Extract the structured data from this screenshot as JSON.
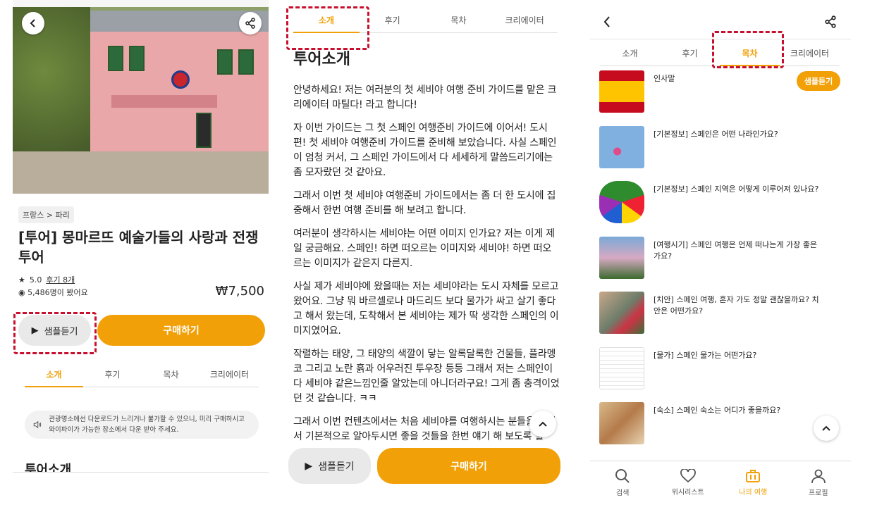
{
  "panel1": {
    "breadcrumb": "프랑스 > 파리",
    "title": "[투어] 몽마르뜨 예술가들의 사랑과 전쟁 투어",
    "rating": "5.0",
    "reviews_link": "후기 8개",
    "views": "5,486명이 봤어요",
    "price": "₩7,500",
    "sample_label": "샘플듣기",
    "buy_label": "구매하기",
    "tabs": [
      "소개",
      "후기",
      "목차",
      "크리에이터"
    ],
    "notice": "관광명소에선 다운로드가 느리거나 불가할 수 있으니, 미리 구매하시고 와이파이가 가능한 장소에서 다운 받아 주세요.",
    "section_title": "투어소개"
  },
  "panel2": {
    "tabs": [
      "소개",
      "후기",
      "목차",
      "크리에이터"
    ],
    "title": "투어소개",
    "paragraphs": [
      "안녕하세요! 저는 여러분의 첫 세비야 여행 준비 가이드를 맡은 크리에이터 마틸다! 라고 합니다!",
      "자 이번 가이드는 그 첫 스페인 여행준비 가이드에 이어서! 도시편! 첫 세비야 여행준비 가이드를 준비해 보았습니다. 사실 스페인이 엄청 커서, 그 스페인 가이드에서 다 세세하게 말씀드리기에는 좀 모자랐던 것 같아요.",
      "그래서 이번 첫 세비야 여행준비 가이드에서는 좀 더 한 도시에 집중해서 한번 여행 준비를 해 보려고 합니다.",
      "여러분이 생각하시는 세비야는 어떤 이미지 인가요? 저는 이게 제일 궁금해요. 스페인! 하면 떠오르는 이미지와 세비야! 하면 떠오르는 이미지가 같은지 다른지.",
      "사실 제가 세비야에 왔을때는 저는 세비야라는 도시 자체를 모르고 왔어요. 그냥 뭐 바르셀로나 마드리드 보다 물가가 싸고 살기 좋다고 해서 왔는데, 도착해서 본 세비야는 제가 딱 생각한 스페인의 이미지였어요.",
      "작렬하는 태양, 그 태양의 색깔이 닿는 알록달록한 건물들, 플라멩코 그리고 노란 흙과 어우러진 투우장 등등 그래서 저는 스페인이 다 세비야 같은느낌인줄 알았는데 아니더라구요! 그게 좀 충격이었던 것 같습니다. ㅋㅋ",
      "그래서 이번 컨텐츠에서는 처음 세비야를 여행하시는 분들을 위해서 기본적으로 알아두시면 좋을 것들을 한번 얘기 해 보도록 할"
    ],
    "sample_label": "샘플듣기",
    "buy_label": "구매하기"
  },
  "panel3": {
    "tabs": [
      "소개",
      "후기",
      "목차",
      "크리에이터"
    ],
    "items": [
      {
        "title": "인사말",
        "sample": "샘플듣기"
      },
      {
        "title": "[기본정보] 스페인은 어떤 나라인가요?"
      },
      {
        "title": "[기본정보] 스페인 지역은 어떻게 이루어져 있나요?"
      },
      {
        "title": "[여행시기] 스페인 여행은 언제 떠나는게 가장 좋은 가요?"
      },
      {
        "title": "[치안] 스페인 여행, 혼자 가도 정말 괜찮을까요? 치안은 어떤가요?"
      },
      {
        "title": "[물가] 스페인 물가는 어떤가요?"
      },
      {
        "title": "[숙소] 스페인 숙소는 어디가 좋을까요?"
      }
    ],
    "nav": [
      "검색",
      "위시리스트",
      "나의 여행",
      "프로필"
    ]
  },
  "colors": {
    "accent": "#f2a007",
    "highlight_dash": "#c8102e"
  }
}
